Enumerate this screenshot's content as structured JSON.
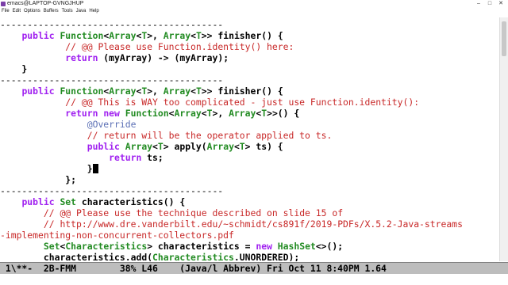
{
  "window": {
    "title": "emacs@LAPTOP-GVNGJHUP"
  },
  "menubar": [
    "File",
    "Edit",
    "Options",
    "Buffers",
    "Tools",
    "Java",
    "Help"
  ],
  "code_lines": [
    "-----------------------------------------",
    "    public Function<Array<T>, Array<T>> finisher() {",
    "            // @@ Please use Function.identity() here:",
    "            return (myArray) -> (myArray);",
    "    }",
    "-----------------------------------------",
    "    public Function<Array<T>, Array<T>> finisher() {",
    "            // @@ This is WAY too complicated - just use Function.identity():",
    "            return new Function<Array<T>, Array<T>>() {",
    "                @Override",
    "                // return will be the operator applied to ts.",
    "                public Array<T> apply(Array<T> ts) {",
    "                    return ts;",
    "                }",
    "            };",
    "-----------------------------------------",
    "    public Set characteristics() {",
    "        // @@ Please use the technique described on slide 15 of",
    "        // http://www.dre.vanderbilt.edu/~schmidt/cs891f/2019-PDFs/X.5.2-Java-streams",
    "-implementing-non-concurrent-collectors.pdf",
    "        Set<Characteristics> characteristics = new HashSet<>();",
    "        characteristics.add(Characteristics.UNORDERED);"
  ],
  "modeline": {
    "text": " 1\\**-  2B-FMM        38% L46    (Java/l Abbrev) Fri Oct 11 8:40PM 1.64"
  },
  "scrollbar": {
    "position_percent": 38
  }
}
